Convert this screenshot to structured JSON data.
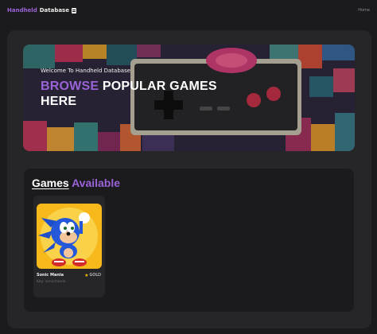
{
  "navbar": {
    "brand_accent": "Handheld",
    "brand_main": "Database",
    "brand_icon": "database-icon",
    "links": [
      {
        "label": "Home"
      }
    ]
  },
  "hero": {
    "welcome": "Welcome To Handheld Database",
    "title_accent": "BROWSE",
    "title_line1_rest": "POPULAR GAMES",
    "title_line2": "HERE"
  },
  "games": {
    "heading_main": "Games",
    "heading_accent": "Available",
    "items": [
      {
        "title": "Sonic Mania",
        "key": "Key: sonicmania",
        "tier": "GOLD",
        "tier_icon": "star-icon"
      }
    ]
  },
  "colors": {
    "accent": "#9b63d8",
    "background": "#1b1b1d",
    "panel": "#262628",
    "gold": "#f2c200"
  }
}
